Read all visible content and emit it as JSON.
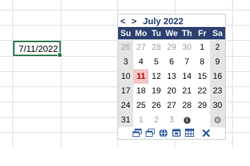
{
  "sheet": {
    "active_cell_value": "7/11/2022"
  },
  "calendar": {
    "prev_label": "<",
    "next_label": ">",
    "month_title": "July 2022",
    "weekdays": [
      "Su",
      "Mo",
      "Tu",
      "We",
      "Th",
      "Fr",
      "Sa"
    ],
    "weeks": [
      [
        "26",
        "27",
        "28",
        "29",
        "30",
        "1",
        "2"
      ],
      [
        "3",
        "4",
        "5",
        "6",
        "7",
        "8",
        "9"
      ],
      [
        "10",
        "11",
        "12",
        "13",
        "14",
        "15",
        "16"
      ],
      [
        "17",
        "18",
        "19",
        "20",
        "21",
        "22",
        "23"
      ],
      [
        "24",
        "25",
        "26",
        "27",
        "28",
        "29",
        "30"
      ],
      [
        "31",
        "1",
        "2",
        "3",
        "",
        "",
        ""
      ]
    ],
    "selected_day": "11",
    "info_icon": "i",
    "settings_icon": "gear-icon",
    "toolbar_icons": [
      "restore-window-icon",
      "window-icon",
      "globe-icon",
      "calendar-number-icon",
      "calendar-grid-icon",
      "close-icon"
    ],
    "colors": {
      "header_bg": "#2c4170",
      "title": "#1f3c6e",
      "weekend_bg": "#e4e4e4",
      "today_bg": "#f4c6c6",
      "today_text": "#c00000",
      "cell_border": "#217346"
    }
  }
}
